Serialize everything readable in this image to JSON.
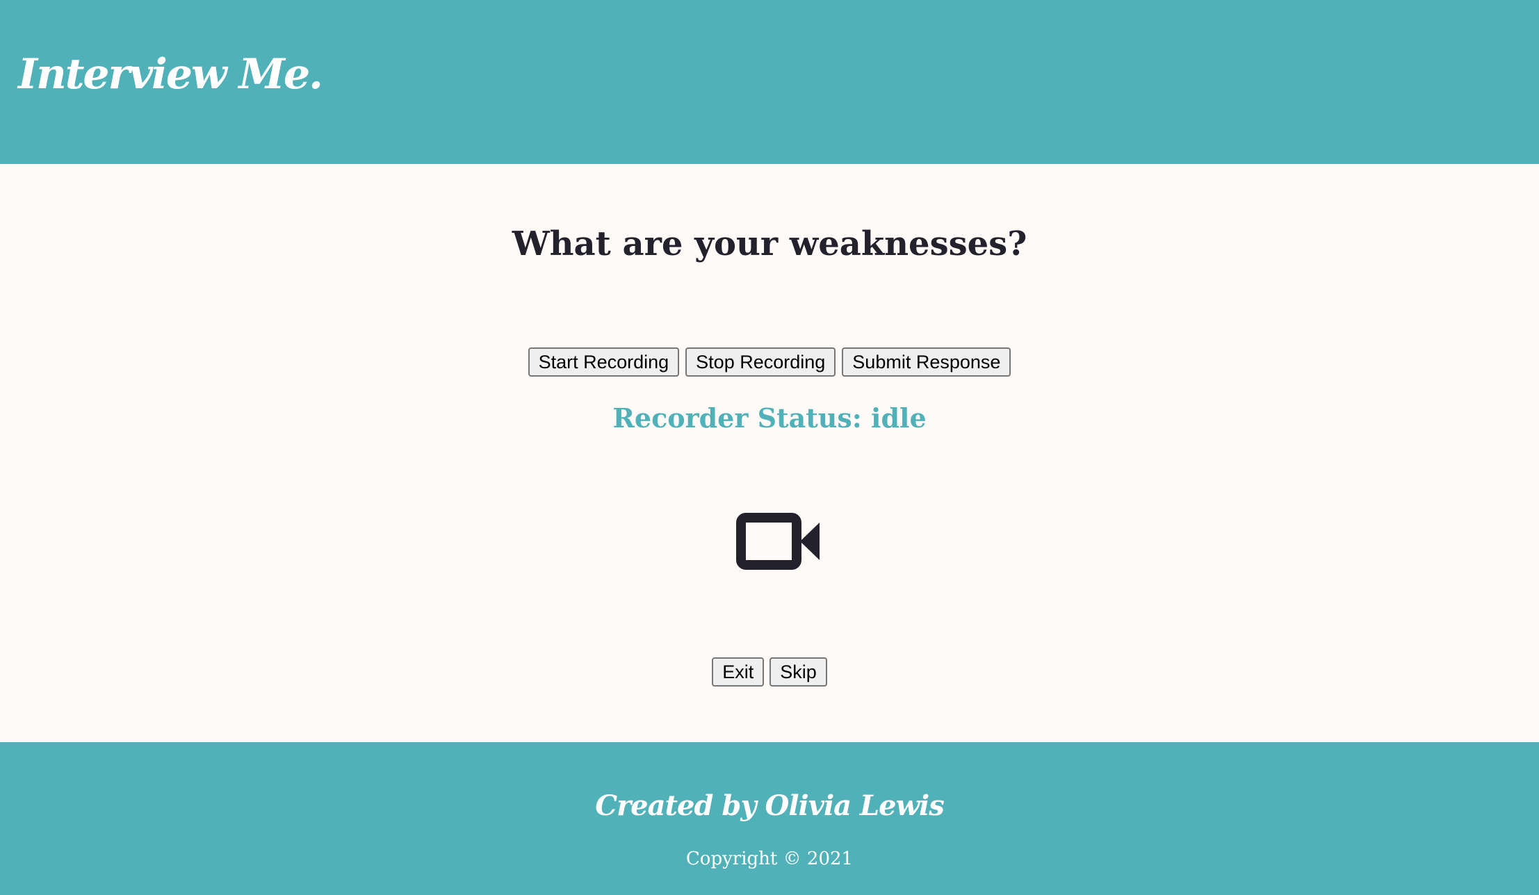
{
  "header": {
    "brand": "Interview Me."
  },
  "main": {
    "question": "What are your weaknesses?",
    "controls": {
      "start_label": "Start Recording",
      "stop_label": "Stop Recording",
      "submit_label": "Submit Response"
    },
    "status_text": "Recorder Status: idle",
    "camera_icon": "video-camera-icon",
    "nav": {
      "exit_label": "Exit",
      "skip_label": "Skip"
    }
  },
  "footer": {
    "credit": "Created by Olivia Lewis",
    "copyright": "Copyright © 2021"
  },
  "colors": {
    "accent": "#51b1b8",
    "text": "#23222c",
    "background": "#fdfaf8"
  }
}
